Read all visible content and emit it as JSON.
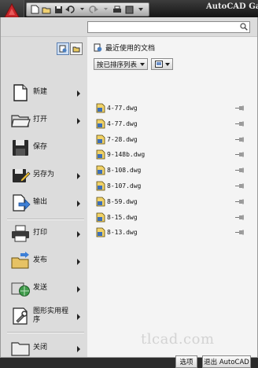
{
  "titlebar": {
    "app_title": "AutoCAD Gar",
    "quick_access": [
      "new-icon",
      "open-icon",
      "save-icon",
      "undo-icon",
      "redo-icon",
      "plot-icon",
      "workspace-icon"
    ]
  },
  "search": {
    "placeholder": "",
    "value": ""
  },
  "left_menu": {
    "items": [
      {
        "label": "新建",
        "icon": "new-document-icon",
        "has_submenu": true
      },
      {
        "label": "打开",
        "icon": "open-folder-icon",
        "has_submenu": true
      },
      {
        "label": "保存",
        "icon": "floppy-disk-icon",
        "has_submenu": false
      },
      {
        "label": "另存为",
        "icon": "save-as-icon",
        "has_submenu": true
      },
      {
        "label": "输出",
        "icon": "export-icon",
        "has_submenu": true
      },
      {
        "label": "打印",
        "icon": "printer-icon",
        "has_submenu": true
      },
      {
        "label": "发布",
        "icon": "publish-icon",
        "has_submenu": true
      },
      {
        "label": "发送",
        "icon": "send-globe-icon",
        "has_submenu": true
      },
      {
        "label": "图形实用程序",
        "icon": "drawing-utilities-icon",
        "has_submenu": true
      },
      {
        "label": "关闭",
        "icon": "close-folder-icon",
        "has_submenu": true
      }
    ]
  },
  "recent": {
    "title": "最近使用的文档",
    "sort_label": "按已排序列表",
    "files": [
      "4-77.dwg",
      "4-77.dwg",
      "7-28.dwg",
      "9-148b.dwg",
      "8-108.dwg",
      "8-107.dwg",
      "8-59.dwg",
      "8-15.dwg",
      "8-13.dwg"
    ]
  },
  "buttons": {
    "options": "选项",
    "exit": "退出 AutoCAD"
  },
  "watermark": "tlcad.com",
  "colors": {
    "title_bg": "#1f1f1f",
    "menu_bg": "#e6e6e6",
    "panel_bg": "#f4f4f4",
    "logo_red": "#c8262a"
  }
}
